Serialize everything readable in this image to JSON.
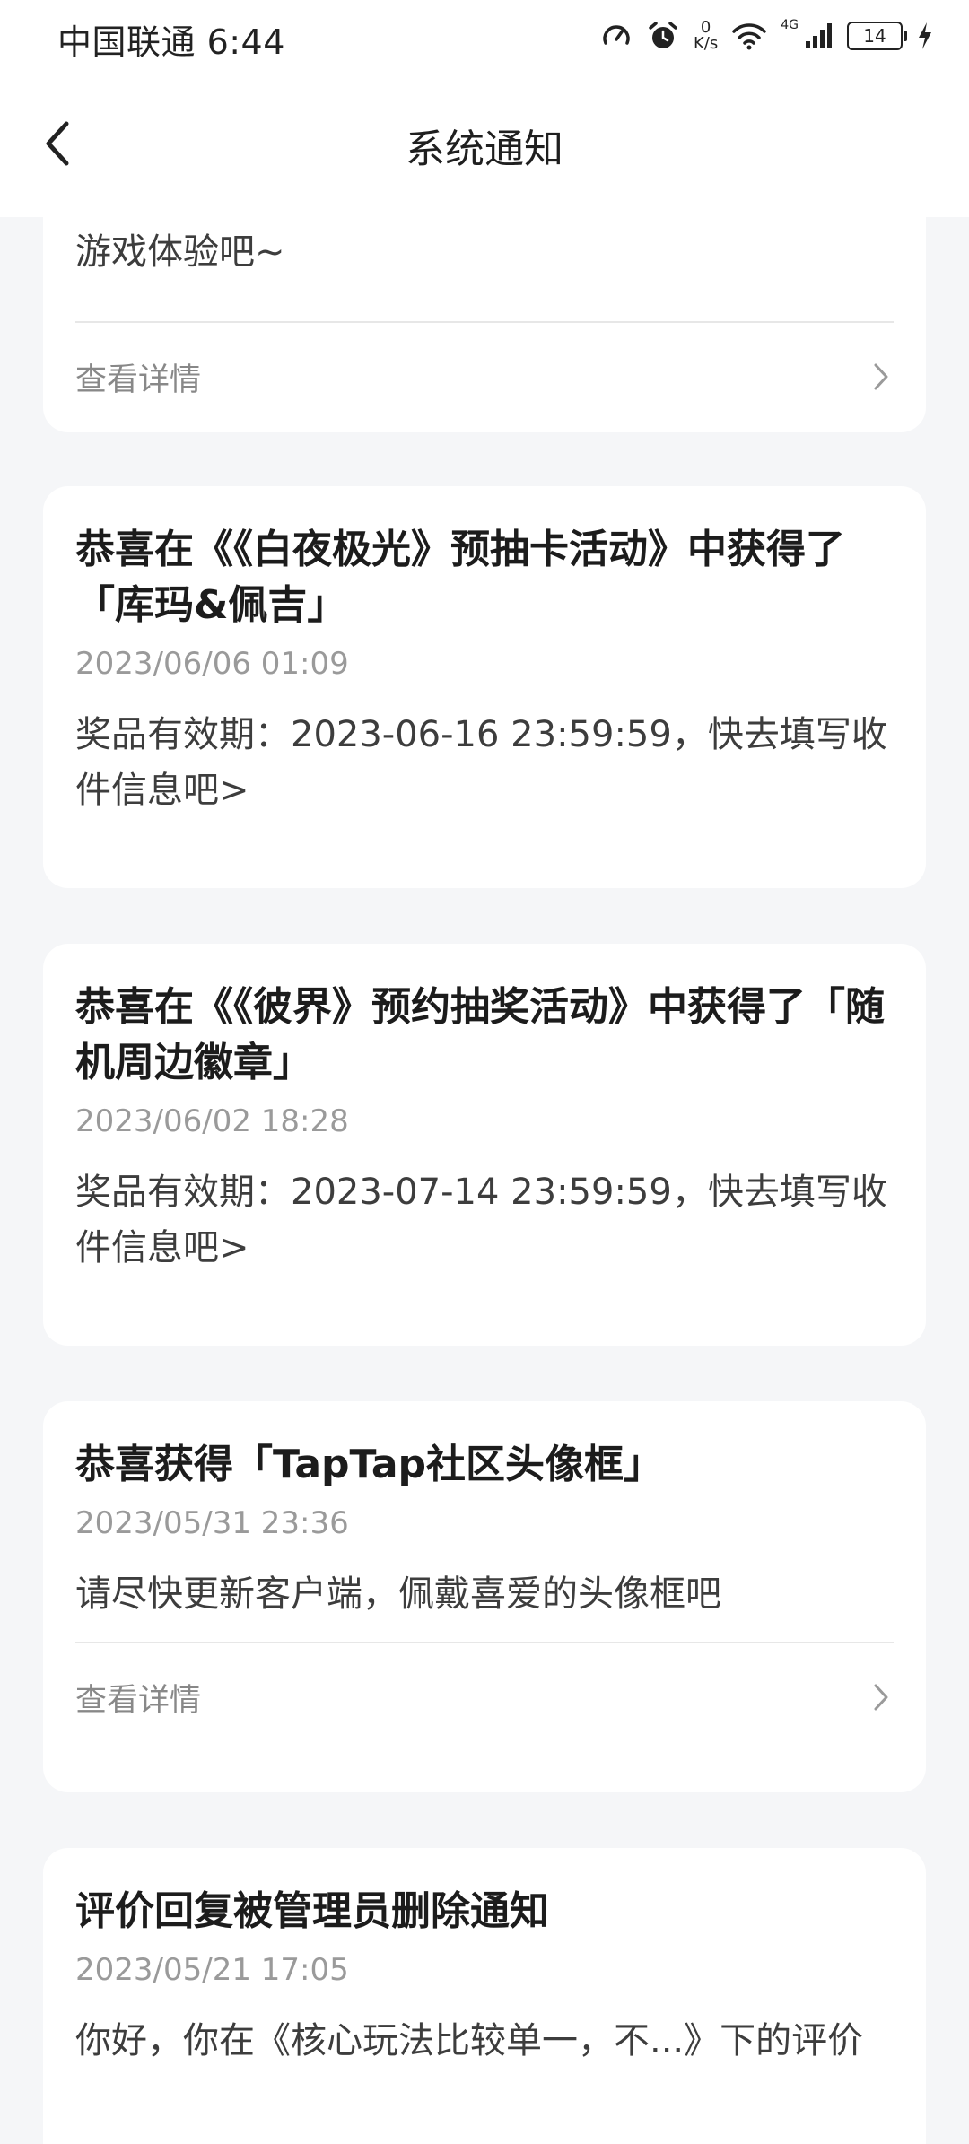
{
  "status_bar": {
    "carrier_time": "中国联通 6:44",
    "net_speed_value": "0",
    "net_speed_unit": "K/s",
    "network": "4G",
    "battery": "14"
  },
  "header": {
    "title": "系统通知"
  },
  "cards": [
    {
      "body": "游戏体验吧~",
      "detail_label": "查看详情"
    },
    {
      "title": "恭喜在《《白夜极光》预抽卡活动》中获得了「库玛&佩吉」",
      "date": "2023/06/06 01:09",
      "body": "奖品有效期：2023-06-16 23:59:59，快去填写收件信息吧>"
    },
    {
      "title": "恭喜在《《彼界》预约抽奖活动》中获得了「随机周边徽章」",
      "date": "2023/06/02 18:28",
      "body": "奖品有效期：2023-07-14 23:59:59，快去填写收件信息吧>"
    },
    {
      "title": "恭喜获得「TapTap社区头像框」",
      "date": "2023/05/31 23:36",
      "body": "请尽快更新客户端，佩戴喜爱的头像框吧",
      "detail_label": "查看详情"
    },
    {
      "title": "评价回复被管理员删除通知",
      "date": "2023/05/21 17:05",
      "body": "你好，你在《核心玩法比较单一，不...》下的评价"
    }
  ],
  "colors": {
    "background": "#f5f6f8",
    "card": "#ffffff",
    "muted_text": "#9a9a9a"
  }
}
